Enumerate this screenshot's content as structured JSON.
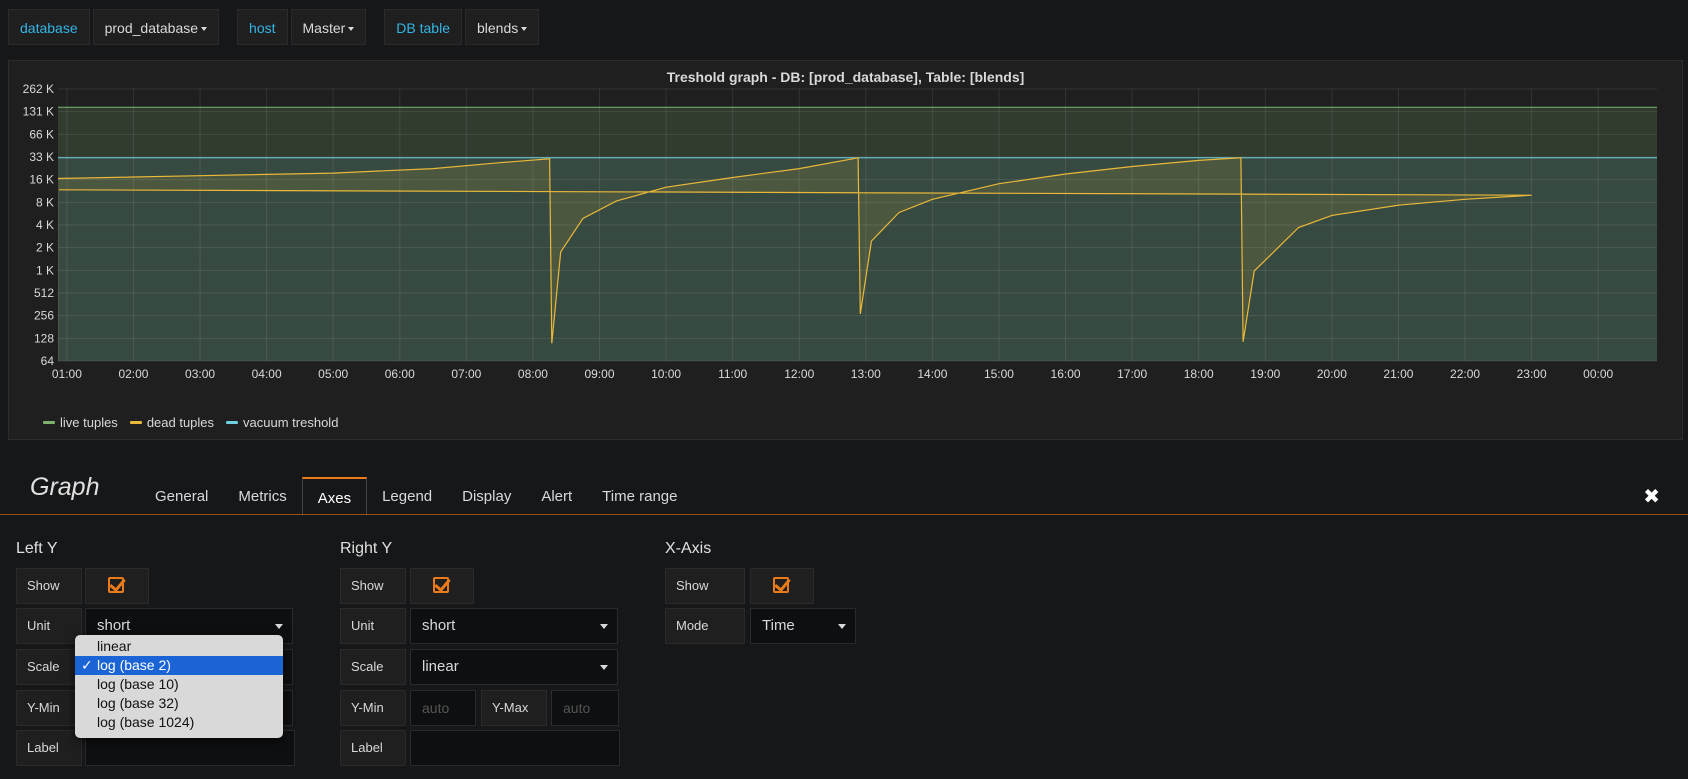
{
  "variables": [
    {
      "label": "database",
      "value": "prod_database"
    },
    {
      "label": "host",
      "value": "Master"
    },
    {
      "label": "DB table",
      "value": "blends"
    }
  ],
  "panel": {
    "title": "Treshold graph - DB: [prod_database], Table: [blends]"
  },
  "chart_data": {
    "type": "line",
    "title": "Treshold graph - DB: [prod_database], Table: [blends]",
    "y_scale": "log2",
    "ylim": [
      64,
      262144
    ],
    "y_ticks": [
      "262 K",
      "131 K",
      "66 K",
      "33 K",
      "16 K",
      "8 K",
      "4 K",
      "2 K",
      "1 K",
      "512",
      "256",
      "128",
      "64"
    ],
    "x_ticks": [
      "01:00",
      "02:00",
      "03:00",
      "04:00",
      "05:00",
      "06:00",
      "07:00",
      "08:00",
      "09:00",
      "10:00",
      "11:00",
      "12:00",
      "13:00",
      "14:00",
      "15:00",
      "16:00",
      "17:00",
      "18:00",
      "19:00",
      "20:00",
      "21:00",
      "22:00",
      "23:00",
      "00:00"
    ],
    "xlim": [
      "00:52",
      "00:53"
    ],
    "grid": true,
    "legend": "bottom-left",
    "series": [
      {
        "name": "live tuples",
        "color": "#7eb26d",
        "points": [
          [
            "00:52",
            150000
          ],
          [
            "00:53",
            150000
          ]
        ]
      },
      {
        "name": "dead tuples",
        "color": "#eab839",
        "points": [
          [
            "00:52",
            17000
          ],
          [
            "03:00",
            18500
          ],
          [
            "05:00",
            20000
          ],
          [
            "06:30",
            23000
          ],
          [
            "07:30",
            27500
          ],
          [
            "08:15",
            31000
          ],
          [
            "08:17",
            110
          ],
          [
            "08:25",
            1800
          ],
          [
            "08:45",
            5000
          ],
          [
            "09:15",
            8500
          ],
          [
            "10:00",
            13000
          ],
          [
            "11:00",
            17500
          ],
          [
            "12:00",
            23000
          ],
          [
            "12:53",
            32000
          ],
          [
            "12:55",
            270
          ],
          [
            "13:05",
            2500
          ],
          [
            "13:30",
            6000
          ],
          [
            "14:00",
            9000
          ],
          [
            "15:00",
            14500
          ],
          [
            "16:00",
            19500
          ],
          [
            "17:00",
            24500
          ],
          [
            "18:00",
            29500
          ],
          [
            "18:38",
            32000
          ],
          [
            "18:40",
            115
          ],
          [
            "18:50",
            1000
          ],
          [
            "19:30",
            3800
          ],
          [
            "20:00",
            5500
          ],
          [
            "21:00",
            7500
          ],
          [
            "22:00",
            9000
          ],
          [
            "23:00",
            10200
          ],
          [
            "00:53",
            12000
          ]
        ]
      },
      {
        "name": "vacuum treshold",
        "color": "#6ed0e0",
        "points": [
          [
            "00:52",
            32000
          ],
          [
            "00:53",
            32000
          ]
        ]
      }
    ]
  },
  "editor": {
    "title": "Graph",
    "tabs": [
      "General",
      "Metrics",
      "Axes",
      "Legend",
      "Display",
      "Alert",
      "Time range"
    ],
    "active_tab": "Axes",
    "close_icon": "close-icon",
    "left_y": {
      "heading": "Left Y",
      "show_label": "Show",
      "unit_label": "Unit",
      "unit_value": "short",
      "scale_label": "Scale",
      "ymin_label": "Y-Min",
      "label_label": "Label"
    },
    "right_y": {
      "heading": "Right Y",
      "show_label": "Show",
      "unit_label": "Unit",
      "unit_value": "short",
      "scale_label": "Scale",
      "scale_value": "linear",
      "ymin_label": "Y-Min",
      "ymin_placeholder": "auto",
      "ymax_label": "Y-Max",
      "ymax_placeholder": "auto",
      "label_label": "Label"
    },
    "x_axis": {
      "heading": "X-Axis",
      "show_label": "Show",
      "mode_label": "Mode",
      "mode_value": "Time"
    },
    "scale_dropdown": {
      "options": [
        "linear",
        "log (base 2)",
        "log (base 10)",
        "log (base 32)",
        "log (base 1024)"
      ],
      "selected": "log (base 2)"
    }
  },
  "colors": {
    "accent": "#eb7b18",
    "link": "#33b5e5"
  }
}
